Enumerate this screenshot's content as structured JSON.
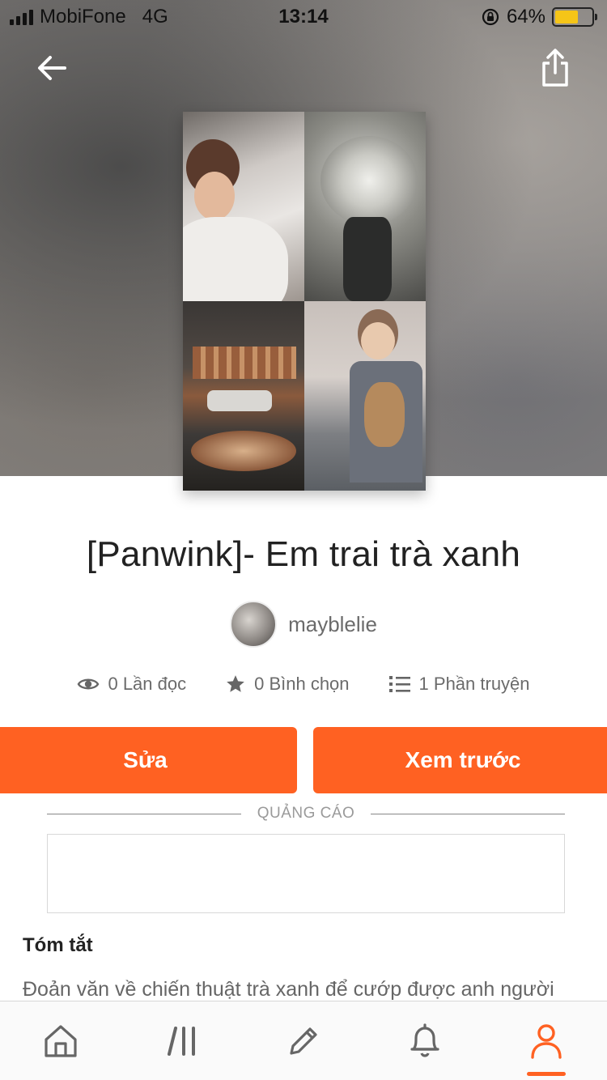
{
  "status_bar": {
    "carrier": "MobiFone",
    "network": "4G",
    "time": "13:14",
    "battery_percent": "64%",
    "battery_level": 0.64,
    "battery_color": "#f5c518"
  },
  "header": {
    "back_icon": "arrow-left-icon",
    "share_icon": "share-icon"
  },
  "story": {
    "title": "[Panwink]- Em trai trà xanh",
    "author": "mayblelie",
    "stats": {
      "reads": "0 Lần đọc",
      "votes": "0 Bình chọn",
      "parts": "1 Phần truyện"
    }
  },
  "actions": {
    "edit_label": "Sửa",
    "preview_label": "Xem trước",
    "accent_color": "#ff6122"
  },
  "ad": {
    "label": "QUẢNG CÁO"
  },
  "summary": {
    "heading": "Tóm tắt",
    "text": "Đoản văn về chiến thuật trà xanh để cướp được anh người"
  },
  "tab_bar": {
    "items": [
      "home-icon",
      "library-icon",
      "write-icon",
      "notifications-icon",
      "profile-icon"
    ],
    "active_index": 4
  }
}
